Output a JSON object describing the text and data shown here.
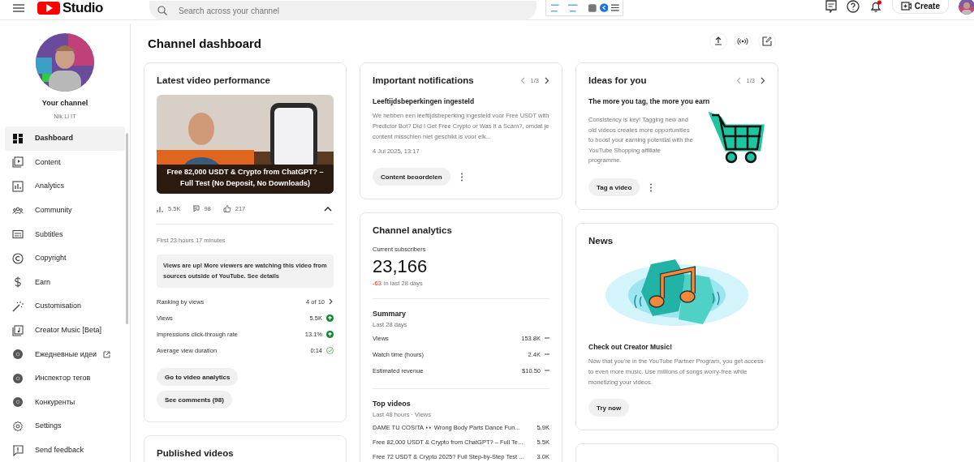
{
  "header": {
    "logo_text": "Studio",
    "search": {
      "placeholder": "Search across your channel"
    },
    "create_label": "Create",
    "notification_dot": true
  },
  "sidebar": {
    "channel_label": "Your channel",
    "channel_name": "Nik Li IT",
    "items": [
      {
        "label": "Dashboard",
        "selected": true,
        "kind": "nav"
      },
      {
        "label": "Content",
        "selected": false,
        "kind": "nav"
      },
      {
        "label": "Analytics",
        "selected": false,
        "kind": "nav"
      },
      {
        "label": "Community",
        "selected": false,
        "kind": "nav"
      },
      {
        "label": "Subtitles",
        "selected": false,
        "kind": "nav"
      },
      {
        "label": "Copyright",
        "selected": false,
        "kind": "nav"
      },
      {
        "label": "Earn",
        "selected": false,
        "kind": "nav"
      },
      {
        "label": "Customisation",
        "selected": false,
        "kind": "nav"
      },
      {
        "label": "Creator Music [Beta]",
        "selected": false,
        "kind": "nav"
      },
      {
        "label": "Ежедневные идеи",
        "selected": false,
        "kind": "extension",
        "external": true
      },
      {
        "label": "Инспектор тегов",
        "selected": false,
        "kind": "extension",
        "external": false
      },
      {
        "label": "Конкуренты",
        "selected": false,
        "kind": "extension",
        "external": false
      },
      {
        "label": "Settings",
        "selected": false,
        "kind": "nav"
      },
      {
        "label": "Send feedback",
        "selected": false,
        "kind": "nav"
      }
    ]
  },
  "page_title": "Channel dashboard",
  "latest": {
    "title": "Latest video performance",
    "video_title": "Free 82,000 USDT & Crypto from ChatGPT? – Full Test (No Deposit, No Downloads)",
    "views": "5.5K",
    "comments": "98",
    "likes": "217",
    "period": "First 23 hours 17 minutes",
    "notice": "Views are up! More viewers are watching this video from sources outside of YouTube. See details",
    "metrics": [
      {
        "label": "Ranking by views",
        "value": "4 of 10",
        "kind": "link"
      },
      {
        "label": "Views",
        "value": "5.5K",
        "kind": "up"
      },
      {
        "label": "Impressions click-through rate",
        "value": "13.1%",
        "kind": "up"
      },
      {
        "label": "Average view duration",
        "value": "0:14",
        "kind": "ok"
      }
    ],
    "buttons": [
      "Go to video analytics",
      "See comments (98)"
    ]
  },
  "published": {
    "title": "Published videos"
  },
  "notifications": {
    "title": "Important notifications",
    "pager": "1/3",
    "heading": "Leeftijdsbeperkingen ingesteld",
    "body": "We hebben een leeftijdsbeperking ingesteld voor Free USDT with Predictor Bot? Did I Get Free Crypto or Was It a Scam?, omdat je content misschien niet geschikt is voor elk...",
    "date": "4 Jul 2025, 13:17",
    "button": "Content beoordelen"
  },
  "analytics": {
    "title": "Channel analytics",
    "subscribers_label": "Current subscribers",
    "subscribers": "23,166",
    "change": "-63",
    "change_suffix": "in last 28 days",
    "summary_title": "Summary",
    "summary_period": "Last 28 days",
    "summary": [
      {
        "label": "Views",
        "value": "153.8K"
      },
      {
        "label": "Watch time (hours)",
        "value": "2.4K"
      },
      {
        "label": "Estimated revenue",
        "value": "$10.50"
      }
    ],
    "top_title": "Top videos",
    "top_period": "Last 48 hours · Views",
    "top": [
      {
        "title": "DAME TU COSITA 👀 Wrong Body Parts Dance Fun...",
        "views": "5.9K"
      },
      {
        "title": "Free 82,000 USDT & Crypto from ChatGPT? – Full Te...",
        "views": "5.5K"
      },
      {
        "title": "Free 72 USDT & Crypto 2025? Full Step-by-Step Test ...",
        "views": "3.0K"
      }
    ]
  },
  "ideas": {
    "title": "Ideas for you",
    "pager": "1/3",
    "heading": "The more you tag, the more you earn",
    "body": "Consistency is key! Tagging new and old videos creates more opportunities to boost your earning potential with the YouTube Shopping affiliate programme.",
    "button": "Tag a video"
  },
  "news": {
    "title": "News",
    "heading": "Check out Creator Music!",
    "body": "Now that you're in the YouTube Partner Program, you get access to even more music. Use millions of songs worry-free while monetizing your videos.",
    "button": "Try now"
  }
}
